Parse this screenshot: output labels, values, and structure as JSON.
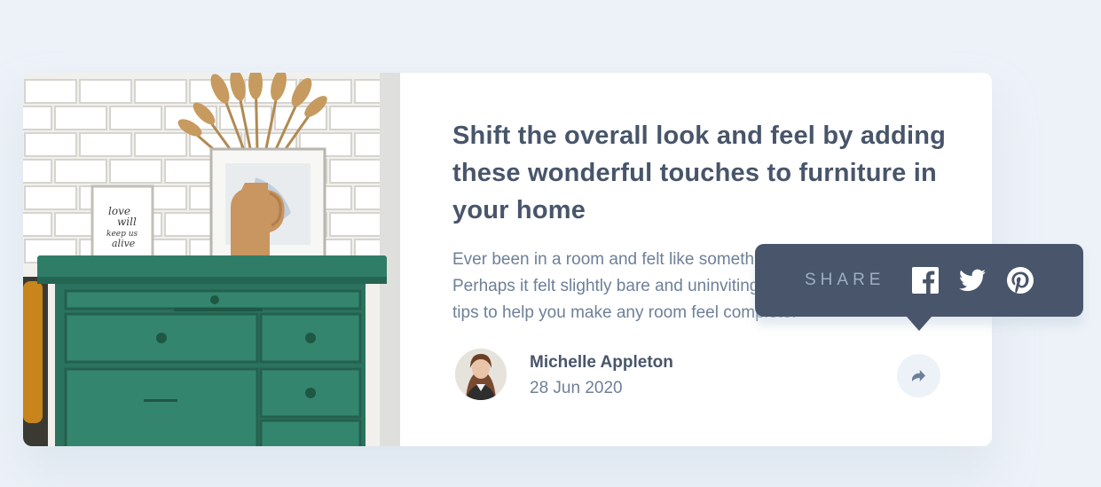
{
  "article": {
    "title": "Shift the overall look and feel by adding these wonderful touches to furniture in your home",
    "excerpt": "Ever been in a room and felt like something was missing? Perhaps it felt slightly bare and uninviting. I’ve got some simple tips to help you make any room feel complete.",
    "image_alt": "drawers"
  },
  "author": {
    "name": "Michelle Appleton",
    "date": "28 Jun 2020"
  },
  "share": {
    "label": "SHARE",
    "icons": [
      "facebook-icon",
      "twitter-icon",
      "pinterest-icon",
      "share-arrow-icon"
    ]
  },
  "photo_art": {
    "frame_text": [
      "love",
      "will",
      "keep us",
      "alive"
    ]
  },
  "colors": {
    "background": "#ecf2f8",
    "card": "#ffffff",
    "heading": "#48556a",
    "body_text": "#6e8098",
    "popup": "#48556a",
    "share_label": "#9eafc2",
    "dresser": "#2e7a63"
  }
}
